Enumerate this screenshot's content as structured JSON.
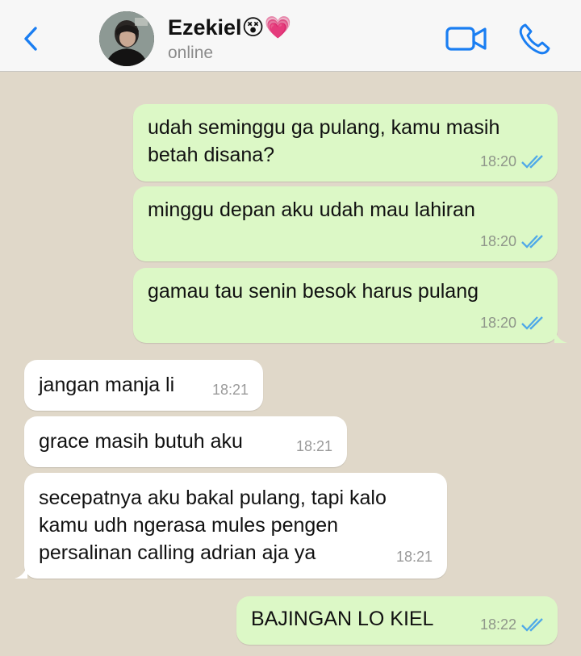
{
  "header": {
    "contact_name": "Ezekiel😵💗",
    "status": "online"
  },
  "colors": {
    "accent": "#1a7ef2",
    "outgoing_bubble": "#dcf8c6",
    "incoming_bubble": "#ffffff",
    "chat_background": "#e0d8c9",
    "read_ticks": "#4fa9e8"
  },
  "icons": {
    "back": "chevron-left-icon",
    "video": "video-camera-icon",
    "phone": "phone-icon",
    "read": "double-check-icon"
  },
  "messages": [
    {
      "direction": "outgoing",
      "lines": [
        "udah seminggu ga pulang, kamu masih",
        "betah disana?"
      ],
      "time": "18:20",
      "read": true
    },
    {
      "direction": "outgoing",
      "lines": [
        "minggu depan aku udah mau lahiran"
      ],
      "time": "18:20",
      "read": true
    },
    {
      "direction": "outgoing",
      "lines": [
        "gamau tau senin besok harus pulang"
      ],
      "time": "18:20",
      "read": true
    },
    {
      "direction": "incoming",
      "lines": [
        "jangan manja li"
      ],
      "time": "18:21"
    },
    {
      "direction": "incoming",
      "lines": [
        "grace masih butuh aku"
      ],
      "time": "18:21"
    },
    {
      "direction": "incoming",
      "lines": [
        "secepatnya aku bakal pulang, tapi kalo",
        "kamu udh ngerasa mules pengen",
        "persalinan calling adrian aja ya"
      ],
      "time": "18:21"
    },
    {
      "direction": "outgoing",
      "lines": [
        "BAJINGAN LO KIEL"
      ],
      "time": "18:22",
      "read": true
    }
  ]
}
